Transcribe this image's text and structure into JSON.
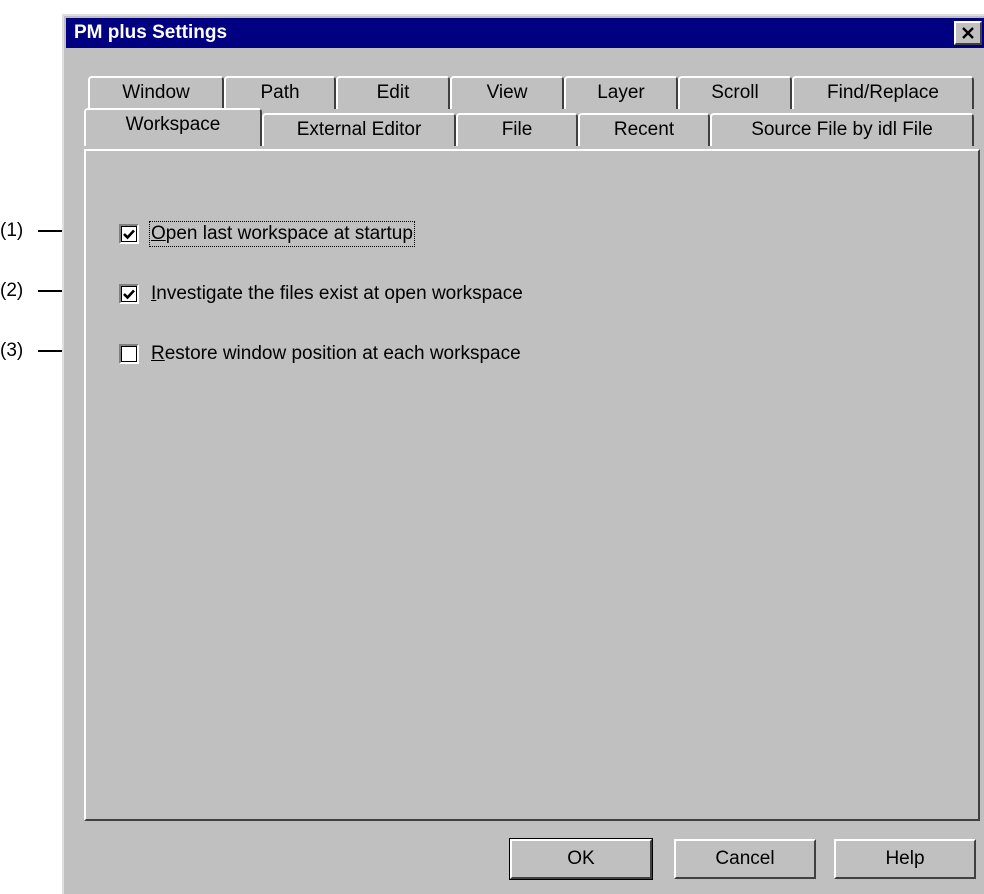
{
  "dialog": {
    "title": "PM plus Settings",
    "close_icon": "close-icon"
  },
  "tabs": {
    "row_back": [
      "Window",
      "Path",
      "Edit",
      "View",
      "Layer",
      "Scroll",
      "Find/Replace"
    ],
    "row_front": [
      "Workspace",
      "External Editor",
      "File",
      "Recent",
      "Source File by idl File"
    ],
    "active": "Workspace"
  },
  "options": [
    {
      "mnemonic": "O",
      "rest": "pen last workspace at startup",
      "checked": true
    },
    {
      "mnemonic": "I",
      "rest": "nvestigate the files exist at open workspace",
      "checked": true
    },
    {
      "mnemonic": "R",
      "rest": "estore window position at each workspace",
      "checked": false
    }
  ],
  "callouts": [
    "(1)",
    "(2)",
    "(3)"
  ],
  "buttons": {
    "ok": "OK",
    "cancel": "Cancel",
    "help": "Help"
  },
  "colors": {
    "titlebar": "#000080",
    "face": "#c0c0c0"
  }
}
